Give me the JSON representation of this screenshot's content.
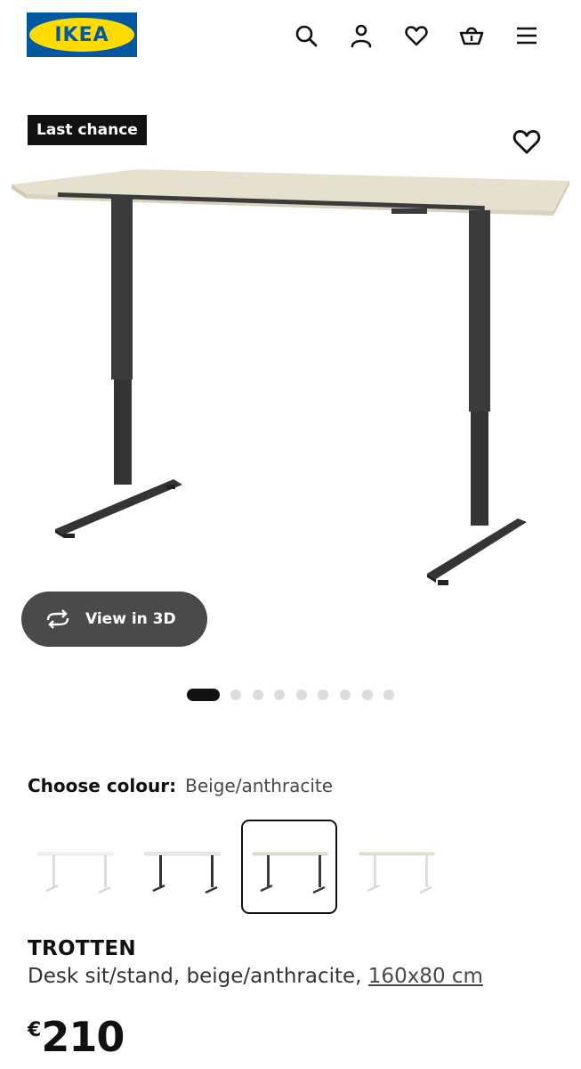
{
  "header": {
    "logo_text": "IKEA",
    "icons": [
      "search-icon",
      "profile-icon",
      "heart-icon",
      "basket-icon",
      "menu-icon"
    ]
  },
  "product": {
    "badge": "Last chance",
    "view_3d_label": "View in 3D",
    "gallery": {
      "total_images": 9,
      "active_index": 0
    },
    "colour_label": "Choose colour:",
    "colour_value": "Beige/anthracite",
    "swatches": [
      {
        "name": "white",
        "selected": false
      },
      {
        "name": "white/black",
        "selected": false
      },
      {
        "name": "beige/anthracite",
        "selected": true
      },
      {
        "name": "beige/white",
        "selected": false
      }
    ],
    "name": "TROTTEN",
    "description": "Desk sit/stand, beige/anthracite,",
    "size": "160x80 cm",
    "currency": "€",
    "price": "210"
  },
  "colors": {
    "ikea_blue": "#0058a3",
    "ikea_yellow": "#ffdb00",
    "desk_top_beige": "#e8e3d3",
    "desk_frame": "#3a3b3a"
  }
}
